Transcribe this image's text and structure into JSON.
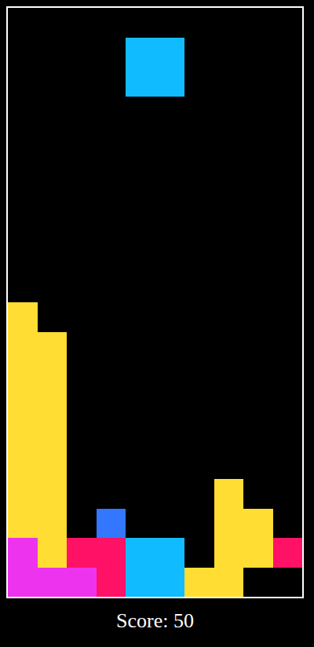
{
  "board": {
    "rows": [
      [
        null,
        null,
        null,
        null,
        null,
        null,
        null,
        null,
        null,
        null
      ],
      [
        null,
        null,
        null,
        null,
        "#11bbff",
        "#11bbff",
        null,
        null,
        null,
        null
      ],
      [
        null,
        null,
        null,
        null,
        "#11bbff",
        "#11bbff",
        null,
        null,
        null,
        null
      ],
      [
        null,
        null,
        null,
        null,
        null,
        null,
        null,
        null,
        null,
        null
      ],
      [
        null,
        null,
        null,
        null,
        null,
        null,
        null,
        null,
        null,
        null
      ],
      [
        null,
        null,
        null,
        null,
        null,
        null,
        null,
        null,
        null,
        null
      ],
      [
        null,
        null,
        null,
        null,
        null,
        null,
        null,
        null,
        null,
        null
      ],
      [
        null,
        null,
        null,
        null,
        null,
        null,
        null,
        null,
        null,
        null
      ],
      [
        null,
        null,
        null,
        null,
        null,
        null,
        null,
        null,
        null,
        null
      ],
      [
        null,
        null,
        null,
        null,
        null,
        null,
        null,
        null,
        null,
        null
      ],
      [
        "#ffdd33",
        null,
        null,
        null,
        null,
        null,
        null,
        null,
        null,
        null
      ],
      [
        "#ffdd33",
        "#ffdd33",
        null,
        null,
        null,
        null,
        null,
        null,
        null,
        null
      ],
      [
        "#ffdd33",
        "#ffdd33",
        null,
        null,
        null,
        null,
        null,
        null,
        null,
        null
      ],
      [
        "#ffdd33",
        "#ffdd33",
        null,
        null,
        null,
        null,
        null,
        null,
        null,
        null
      ],
      [
        "#ffdd33",
        "#ffdd33",
        null,
        null,
        null,
        null,
        null,
        null,
        null,
        null
      ],
      [
        "#ffdd33",
        "#ffdd33",
        null,
        null,
        null,
        null,
        null,
        null,
        null,
        null
      ],
      [
        "#ffdd33",
        "#ffdd33",
        null,
        null,
        null,
        null,
        null,
        "#ffdd33",
        null,
        null
      ],
      [
        "#ffdd33",
        "#ffdd33",
        null,
        "#3377ff",
        null,
        null,
        null,
        "#ffdd33",
        "#ffdd33",
        null
      ],
      [
        "#ee33ee",
        "#ffdd33",
        "#ff1166",
        "#ff1166",
        "#11bbff",
        "#11bbff",
        null,
        "#ffdd33",
        "#ffdd33",
        "#ff1166"
      ],
      [
        "#ee33ee",
        "#ee33ee",
        "#ee33ee",
        "#ff1166",
        "#11bbff",
        "#11bbff",
        "#ffdd33",
        "#ffdd33",
        null,
        null
      ]
    ]
  },
  "score": "Score: 50"
}
